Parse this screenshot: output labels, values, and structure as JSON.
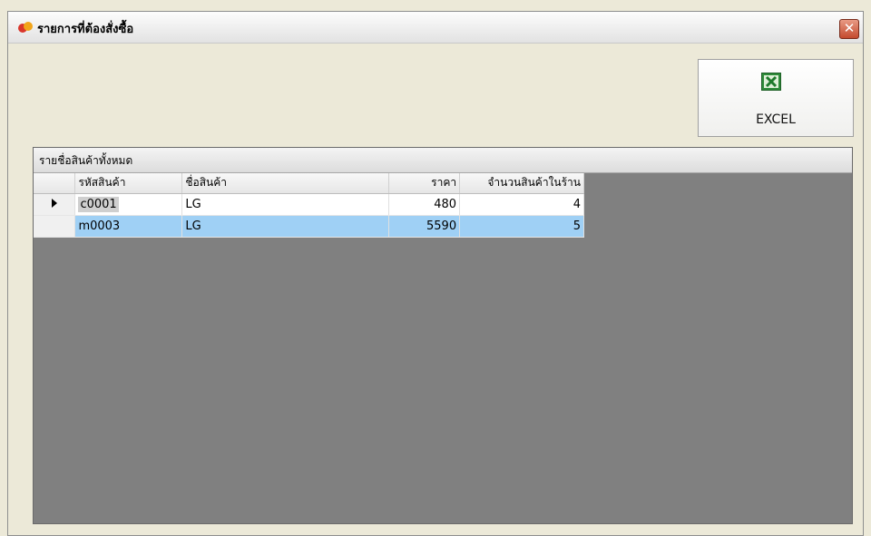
{
  "window": {
    "title": "รายการที่ต้องสั่งซื้อ",
    "close_label": "✕"
  },
  "toolbar": {
    "excel_label": "EXCEL"
  },
  "panel": {
    "caption": "รายชื่อสินค้าทั้งหมด"
  },
  "grid": {
    "columns": [
      "รหัสสินค้า",
      "ชื่อสินค้า",
      "ราคา",
      "จำนวนสินค้าในร้าน"
    ],
    "rows": [
      {
        "code": "c0001",
        "name": "LG",
        "price": "480",
        "qty": "4"
      },
      {
        "code": "m0003",
        "name": "LG",
        "price": "5590",
        "qty": "5"
      }
    ]
  },
  "icons": {
    "app": "app-icon",
    "excel": "excel-icon",
    "row_indicator": "row-pointer-icon"
  },
  "colors": {
    "selected_row": "#9fd0f5",
    "panel_background": "#808080",
    "close_button": "#c44a2e"
  }
}
